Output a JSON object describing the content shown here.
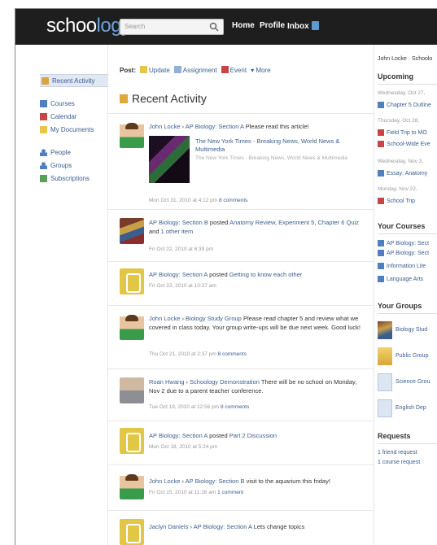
{
  "topbar": {
    "logo_main": "schoo",
    "logo_accent": "logy",
    "search_placeholder": "Search",
    "nav": {
      "home": "Home",
      "profile": "Profile",
      "inbox": "Inbox"
    }
  },
  "sidebar": {
    "items": [
      {
        "label": "Recent Activity",
        "icon": "recent-activity-icon"
      },
      {
        "label": "Courses",
        "icon": "courses-icon"
      },
      {
        "label": "Calendar",
        "icon": "calendar-icon"
      },
      {
        "label": "My Documents",
        "icon": "documents-icon"
      },
      {
        "label": "People",
        "icon": "people-icon"
      },
      {
        "label": "Groups",
        "icon": "groups-icon"
      },
      {
        "label": "Subscriptions",
        "icon": "subscriptions-icon"
      }
    ]
  },
  "postbar": {
    "label": "Post:",
    "update": "Update",
    "assignment": "Assignment",
    "event": "Event",
    "more": "More"
  },
  "main": {
    "heading": "Recent Activity",
    "items": [
      {
        "who": "John Locke",
        "target": "AP Biology: Section A",
        "text": "Please read this article!",
        "embed_title": "The New York Times - Breaking News, World News & Multimedia",
        "embed_sub": "The New York Times - Breaking News, World News & Multimedia",
        "meta": "Mon Oct 31, 2010 at 4:12 pm",
        "comments": "8 comments"
      },
      {
        "who": "AP Biology: Section B",
        "action": "posted",
        "attach1": "Anatomy Review",
        "attach2": "Experiment 5",
        "attach3": "Chapter 6 Quiz",
        "and": "and",
        "other": "1 other item",
        "meta": "Fri Oct 22, 2010 at 6:39 pm"
      },
      {
        "who": "AP Biology: Section A",
        "action": "posted",
        "attach": "Getting to know each other",
        "meta": "Fri Oct 22, 2010 at 10:37 am"
      },
      {
        "who": "John Locke",
        "target": "Biology Study Group",
        "text": "Please read chapter 5 and review what we covered in class today. Your group write-ups will be due next week. Good luck!",
        "meta": "Thu Oct 21, 2010 at 2:37 pm",
        "comments": "8 comments"
      },
      {
        "who": "Roan Hwang",
        "target": "Schoology Demonstration",
        "text": "There will be no school on Monday, Nov 2 due to a parent teacher conference.",
        "meta": "Tue Oct 19, 2010 at 12:56 pm",
        "comments": "8 comments"
      },
      {
        "who": "AP Biology: Section A",
        "action": "posted",
        "attach": "Part 2 Discussion",
        "meta": "Mon Oct 18, 2010 at 5:24 pm"
      },
      {
        "who": "John Locke",
        "target": "AP Biology: Section B",
        "text": "visit to the aquarium this friday!",
        "meta": "Fri Oct 15, 2010 at 11:16 am",
        "comments": "1 comment"
      },
      {
        "who": "Jaclyn Daniels",
        "target": "AP Biology: Section A",
        "text": "Lets change topics"
      }
    ]
  },
  "right": {
    "user_link": "John Locke · Schoolo",
    "upcoming": {
      "title": "Upcoming",
      "entries": [
        {
          "date": "Wednesday, Oct 27,",
          "link": "Chapter 5 Outline"
        },
        {
          "date": "Thursday, Oct 28,",
          "link": "Field Trip to MO"
        },
        {
          "date": "",
          "link": "School-Wide Eve"
        },
        {
          "date": "Wednesday, Nov 3,",
          "link": "Essay: Anatomy"
        },
        {
          "date": "Monday, Nov 22,",
          "link": "School Trip"
        }
      ]
    },
    "courses": {
      "title": "Your Courses",
      "items": [
        "AP Biology: Sect",
        "AP Biology: Sect",
        "Information Lite",
        "Language Arts"
      ]
    },
    "groups": {
      "title": "Your Groups",
      "items": [
        "Biology Stud",
        "Public Group",
        "Science Grou",
        "English Dep"
      ]
    },
    "requests": {
      "title": "Requests",
      "items": [
        "1 friend request",
        "1 course request"
      ]
    }
  }
}
